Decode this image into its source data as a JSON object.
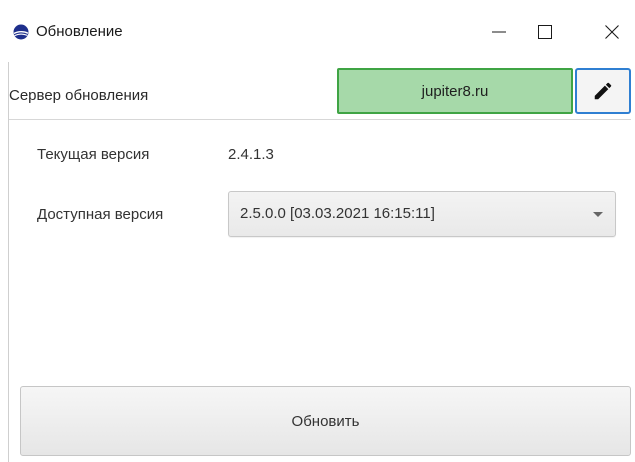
{
  "window": {
    "title": "Обновление",
    "icon": "app-sphere-icon",
    "controls": {
      "minimize_icon": "minimize-icon",
      "maximize_icon": "maximize-icon",
      "close_icon": "close-icon"
    }
  },
  "server": {
    "label": "Сервер обновления",
    "value": "jupiter8.ru",
    "edit_icon": "pencil-icon",
    "field_color": "#a6d9a9",
    "field_border_color": "#3fa444",
    "edit_border_color": "#2f7fd2"
  },
  "current_version": {
    "label": "Текущая версия",
    "value": "2.4.1.3"
  },
  "available_version": {
    "label": "Доступная версия",
    "selected": "2.5.0.0 [03.03.2021 16:15:11]"
  },
  "actions": {
    "update_label": "Обновить"
  }
}
